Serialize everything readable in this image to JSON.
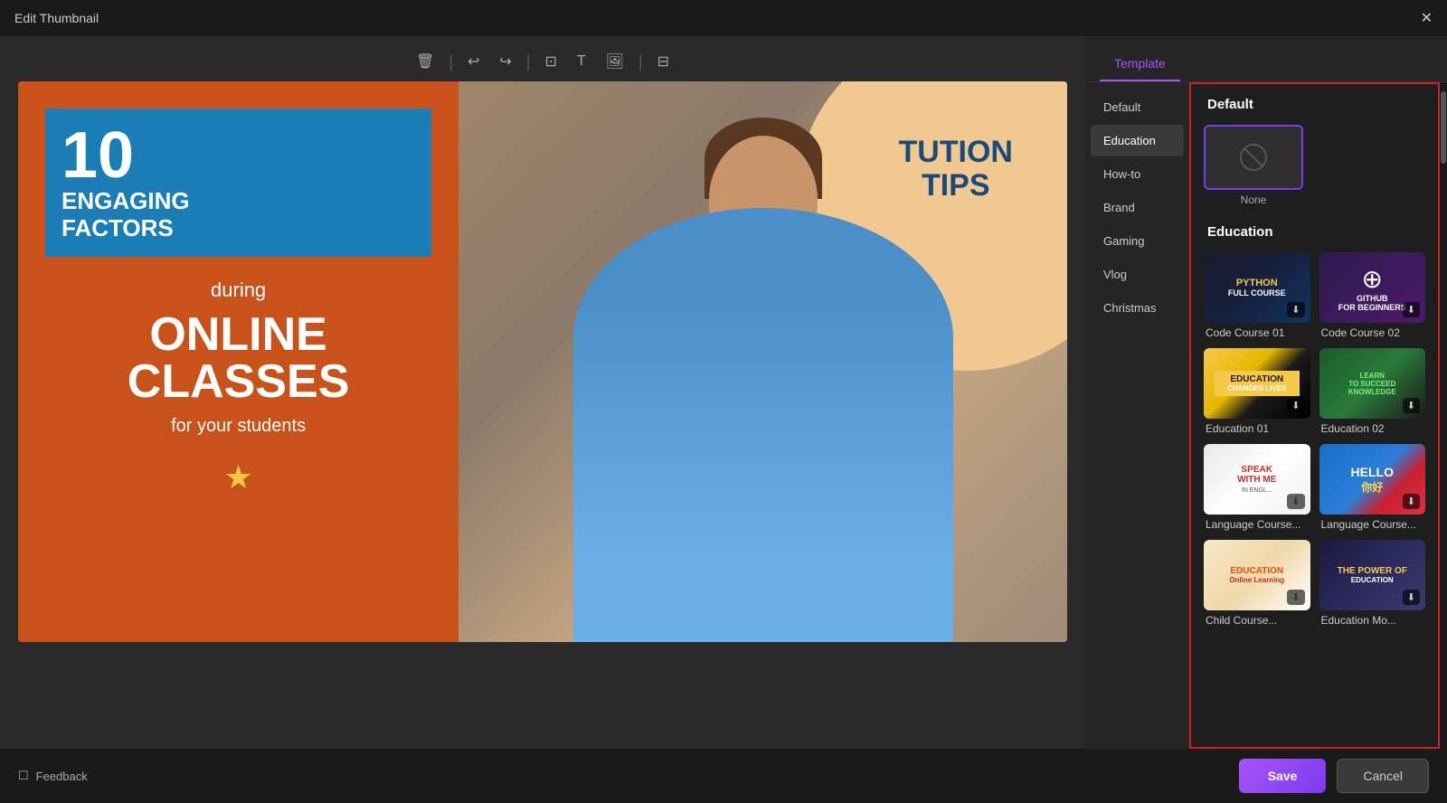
{
  "window": {
    "title": "Edit Thumbnail",
    "close_label": "✕"
  },
  "toolbar": {
    "delete_icon": "🗑",
    "separator1": "|",
    "undo_icon": "↩",
    "redo_icon": "↪",
    "separator2": "|",
    "crop_icon": "⊡",
    "text_icon": "T",
    "image_icon": "⊞",
    "separator3": "|",
    "resize_icon": "⊟"
  },
  "thumbnail": {
    "number": "10",
    "engaging_text": "ENGAGING\nFACTORS",
    "during_text": "during",
    "online_classes": "ONLINE\nCLASSES",
    "students_text": "for your students",
    "star": "★",
    "tution_line1": "TUTION",
    "tution_line2": "TIPS"
  },
  "bottom_bar": {
    "feedback_icon": "☐",
    "feedback_label": "Feedback",
    "save_label": "Save",
    "cancel_label": "Cancel"
  },
  "right_panel": {
    "tab_label": "Template",
    "default_section_title": "Default",
    "default_item_label": "None",
    "education_section_title": "Education",
    "categories": [
      {
        "id": "default",
        "label": "Default",
        "active": false
      },
      {
        "id": "education",
        "label": "Education",
        "active": true
      },
      {
        "id": "howto",
        "label": "How-to",
        "active": false
      },
      {
        "id": "brand",
        "label": "Brand",
        "active": false
      },
      {
        "id": "gaming",
        "label": "Gaming",
        "active": false
      },
      {
        "id": "vlog",
        "label": "Vlog",
        "active": false
      },
      {
        "id": "christmas",
        "label": "Christmas",
        "active": false
      }
    ],
    "templates": [
      {
        "id": "code01",
        "label": "Code Course 01",
        "style": "code01"
      },
      {
        "id": "code02",
        "label": "Code Course 02",
        "style": "code02"
      },
      {
        "id": "edu01",
        "label": "Education 01",
        "style": "edu01"
      },
      {
        "id": "edu02",
        "label": "Education 02",
        "style": "edu02"
      },
      {
        "id": "lang01",
        "label": "Language Course...",
        "style": "lang01"
      },
      {
        "id": "lang02",
        "label": "Language Course...",
        "style": "lang02"
      },
      {
        "id": "child01",
        "label": "Child Course...",
        "style": "child01"
      },
      {
        "id": "child02",
        "label": "Education Mo...",
        "style": "child02"
      }
    ]
  }
}
